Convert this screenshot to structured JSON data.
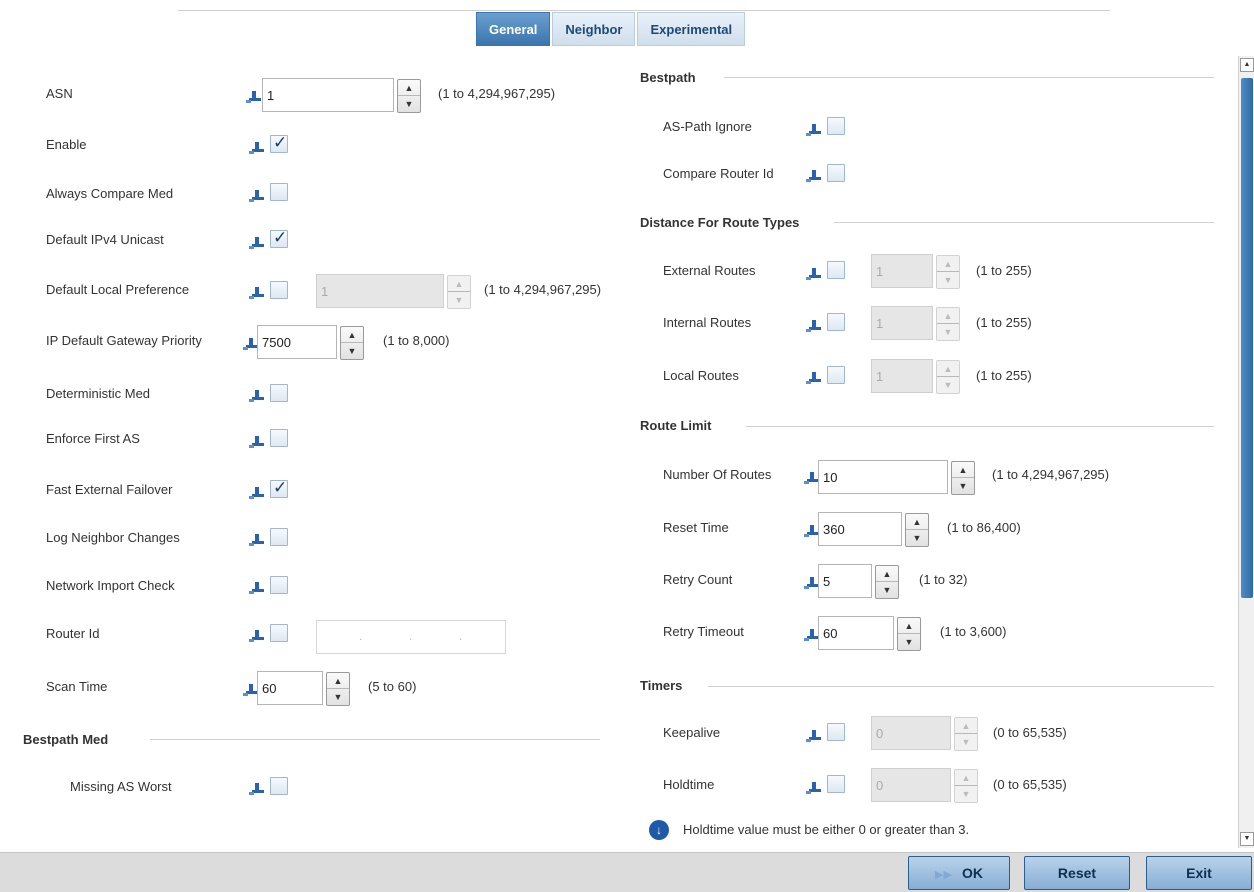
{
  "tabs": [
    {
      "label": "General"
    },
    {
      "label": "Neighbor"
    },
    {
      "label": "Experimental"
    }
  ],
  "left": {
    "asn": {
      "label": "ASN",
      "value": "1",
      "range": "(1 to 4,294,967,295)"
    },
    "enable": {
      "label": "Enable",
      "checked": true
    },
    "always_compare_med": {
      "label": "Always Compare Med",
      "checked": false
    },
    "default_ipv4_unicast": {
      "label": "Default IPv4 Unicast",
      "checked": true
    },
    "default_local_preference": {
      "label": "Default Local Preference",
      "value": "1",
      "range": "(1 to 4,294,967,295)"
    },
    "ip_default_gateway_priority": {
      "label": "IP Default Gateway Priority",
      "value": "7500",
      "range": "(1 to 8,000)"
    },
    "deterministic_med": {
      "label": "Deterministic Med",
      "checked": false
    },
    "enforce_first_as": {
      "label": "Enforce First AS",
      "checked": false
    },
    "fast_external_failover": {
      "label": "Fast External Failover",
      "checked": true
    },
    "log_neighbor_changes": {
      "label": "Log Neighbor Changes",
      "checked": false
    },
    "network_import_check": {
      "label": "Network Import Check",
      "checked": false
    },
    "router_id": {
      "label": "Router Id"
    },
    "scan_time": {
      "label": "Scan Time",
      "value": "60",
      "range": "(5 to 60)"
    },
    "bestpath_med_title": "Bestpath Med",
    "missing_as_worst": {
      "label": "Missing AS Worst",
      "checked": false
    }
  },
  "right": {
    "bestpath_title": "Bestpath",
    "as_path_ignore": {
      "label": "AS-Path Ignore",
      "checked": false
    },
    "compare_router_id": {
      "label": "Compare Router Id",
      "checked": false
    },
    "distance_title": "Distance For Route Types",
    "external_routes": {
      "label": "External Routes",
      "value": "1",
      "range": "(1 to 255)"
    },
    "internal_routes": {
      "label": "Internal Routes",
      "value": "1",
      "range": "(1 to 255)"
    },
    "local_routes": {
      "label": "Local Routes",
      "value": "1",
      "range": "(1 to 255)"
    },
    "route_limit_title": "Route Limit",
    "number_of_routes": {
      "label": "Number Of Routes",
      "value": "10",
      "range": "(1 to 4,294,967,295)"
    },
    "reset_time": {
      "label": "Reset Time",
      "value": "360",
      "range": "(1 to 86,400)"
    },
    "retry_count": {
      "label": "Retry Count",
      "value": "5",
      "range": "(1 to 32)"
    },
    "retry_timeout": {
      "label": "Retry Timeout",
      "value": "60",
      "range": "(1 to 3,600)"
    },
    "timers_title": "Timers",
    "keepalive": {
      "label": "Keepalive",
      "value": "0",
      "range": "(0 to 65,535)"
    },
    "holdtime": {
      "label": "Holdtime",
      "value": "0",
      "range": "(0 to 65,535)"
    },
    "note": "Holdtime value must be either 0 or greater than 3."
  },
  "footer": {
    "ok": "OK",
    "reset": "Reset",
    "exit": "Exit"
  },
  "colors": {
    "accent": "#3b75ad",
    "pin": "#2a62b0",
    "footer_bg": "#dcdcdc"
  },
  "icons": {
    "pin": "pin-icon",
    "info": "info-down-arrow-icon",
    "ok": "double-arrow-icon"
  }
}
